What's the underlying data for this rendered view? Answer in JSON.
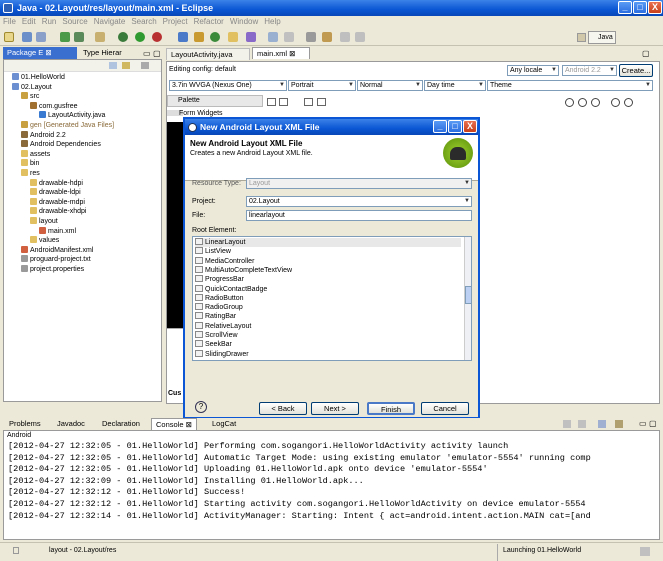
{
  "window": {
    "title": "Java - 02.Layout/res/layout/main.xml - Eclipse",
    "min": "_",
    "max": "□",
    "close": "X"
  },
  "menu": [
    "File",
    "Edit",
    "Run",
    "Source",
    "Navigate",
    "Search",
    "Project",
    "Refactor",
    "Window",
    "Help"
  ],
  "perspective": "Java",
  "left_tabs": {
    "package": "Package E",
    "type": "Type Hierar"
  },
  "tree": [
    {
      "label": "01.HelloWorld",
      "indent": 0,
      "icon": "project-icon"
    },
    {
      "label": "02.Layout",
      "indent": 0,
      "icon": "project-icon"
    },
    {
      "label": "src",
      "indent": 1,
      "icon": "source-folder-icon"
    },
    {
      "label": "com.gusfree",
      "indent": 2,
      "icon": "package-icon"
    },
    {
      "label": "LayoutActivity.java",
      "indent": 3,
      "icon": "java-file-icon"
    },
    {
      "label": "gen [Generated Java Files]",
      "indent": 1,
      "icon": "source-folder-icon"
    },
    {
      "label": "Android 2.2",
      "indent": 1,
      "icon": "library-icon"
    },
    {
      "label": "Android Dependencies",
      "indent": 1,
      "icon": "library-icon"
    },
    {
      "label": "assets",
      "indent": 1,
      "icon": "folder-icon"
    },
    {
      "label": "bin",
      "indent": 1,
      "icon": "folder-icon"
    },
    {
      "label": "res",
      "indent": 1,
      "icon": "folder-icon"
    },
    {
      "label": "drawable-hdpi",
      "indent": 2,
      "icon": "folder-icon"
    },
    {
      "label": "drawable-ldpi",
      "indent": 2,
      "icon": "folder-icon"
    },
    {
      "label": "drawable-mdpi",
      "indent": 2,
      "icon": "folder-icon"
    },
    {
      "label": "drawable-xhdpi",
      "indent": 2,
      "icon": "folder-icon"
    },
    {
      "label": "layout",
      "indent": 2,
      "icon": "folder-icon"
    },
    {
      "label": "main.xml",
      "indent": 3,
      "icon": "xml-file-icon"
    },
    {
      "label": "values",
      "indent": 2,
      "icon": "folder-icon"
    },
    {
      "label": "AndroidManifest.xml",
      "indent": 1,
      "icon": "xml-file-icon"
    },
    {
      "label": "proguard-project.txt",
      "indent": 1,
      "icon": "text-file-icon"
    },
    {
      "label": "project.properties",
      "indent": 1,
      "icon": "text-file-icon"
    }
  ],
  "editor_tabs": {
    "activity": "LayoutActivity.java",
    "main": "main.xml"
  },
  "editor": {
    "config_label": "Editing config: default",
    "locale": "Any locale",
    "api": "Android 2.2",
    "create": "Create...",
    "device": "3.7in WVGA (Nexus One)",
    "orientation": "Portrait",
    "mode": "Normal",
    "daytime": "Day time",
    "theme": "Theme",
    "palette": "Palette",
    "form_widgets": "Form Widgets",
    "custom": "Cus"
  },
  "dialog": {
    "title": "New Android Layout XML File",
    "heading": "New Android Layout XML File",
    "subtitle": "Creates a new Android Layout XML file.",
    "resource_type_label": "Resource Type:",
    "resource_type_value": "Layout",
    "project_label": "Project:",
    "project_value": "02.Layout",
    "file_label": "File:",
    "file_value": "linearlayout",
    "root_label": "Root Element:",
    "root_elements": [
      "LinearLayout",
      "ListView",
      "MediaController",
      "MultiAutoCompleteTextView",
      "ProgressBar",
      "QuickContactBadge",
      "RadioButton",
      "RadioGroup",
      "RatingBar",
      "RelativeLayout",
      "ScrollView",
      "SeekBar",
      "SlidingDrawer"
    ],
    "help": "?",
    "back": "< Back",
    "next": "Next >",
    "finish": "Finish",
    "cancel": "Cancel"
  },
  "bottom_tabs": {
    "problems": "Problems",
    "javadoc": "Javadoc",
    "declaration": "Declaration",
    "console": "Console",
    "logcat": "LogCat"
  },
  "console": {
    "label": "Android",
    "lines": [
      "[2012-04-27 12:32:05 - 01.HelloWorld] Performing com.sogangori.HelloWorldActivity activity launch",
      "[2012-04-27 12:32:05 - 01.HelloWorld] Automatic Target Mode: using existing emulator 'emulator-5554' running comp",
      "[2012-04-27 12:32:05 - 01.HelloWorld] Uploading 01.HelloWorld.apk onto device 'emulator-5554'",
      "[2012-04-27 12:32:09 - 01.HelloWorld] Installing 01.HelloWorld.apk...",
      "[2012-04-27 12:32:12 - 01.HelloWorld] Success!",
      "[2012-04-27 12:32:12 - 01.HelloWorld] Starting activity com.sogangori.HelloWorldActivity on device emulator-5554",
      "[2012-04-27 12:32:14 - 01.HelloWorld] ActivityManager: Starting: Intent { act=android.intent.action.MAIN cat=[and"
    ]
  },
  "status": {
    "left": "layout - 02.Layout/res",
    "right": "Launching 01.HelloWorld"
  }
}
